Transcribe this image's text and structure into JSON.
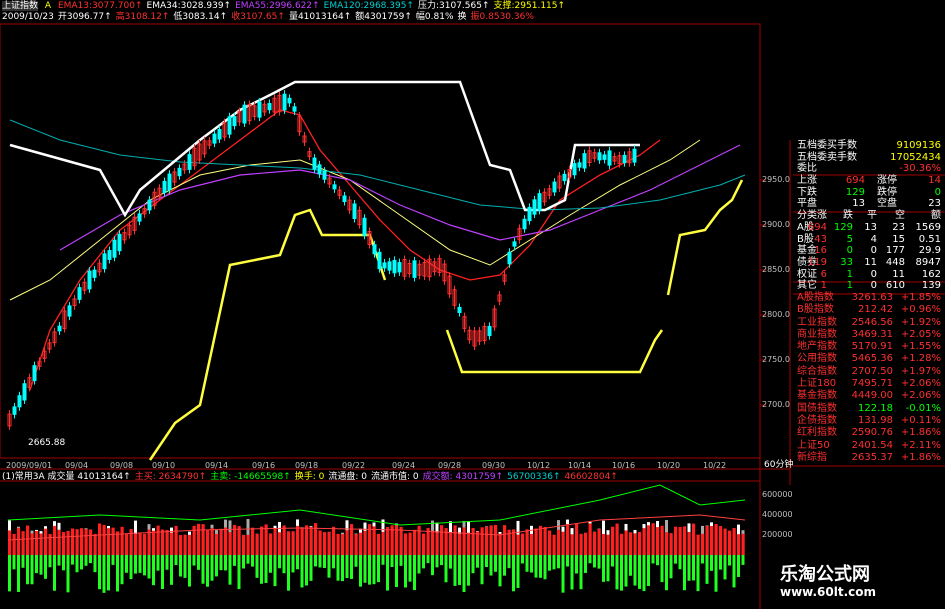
{
  "header1": {
    "title": "上证指数",
    "a_label": "A",
    "ema_items": [
      {
        "text": "EMA13:3077.700↑",
        "color": "#ff3030"
      },
      {
        "text": "EMA34:3028.939↑",
        "color": "#ffffff"
      },
      {
        "text": "EMA55:2996.622↑",
        "color": "#c040ff"
      },
      {
        "text": "EMA120:2968.395↑",
        "color": "#00d0d0"
      },
      {
        "text": "压力:3107.565↑",
        "color": "#ffffff"
      },
      {
        "text": "支撑:2951.115↑",
        "color": "#ffff00"
      }
    ]
  },
  "header2": {
    "items": [
      {
        "text": "2009/10/23",
        "color": "#ffffff"
      },
      {
        "text": "开3096.77↑",
        "color": "#ffffff"
      },
      {
        "text": "高3108.12↑",
        "color": "#ff3030"
      },
      {
        "text": "低3083.14↑",
        "color": "#ffffff"
      },
      {
        "text": "收3107.65↑",
        "color": "#ff3030"
      },
      {
        "text": "量41013164↑",
        "color": "#ffffff"
      },
      {
        "text": "额4301759↑",
        "color": "#ffffff"
      },
      {
        "text": "幅0.81%",
        "color": "#ffffff"
      },
      {
        "text": "换",
        "color": "#ffffff"
      },
      {
        "text": "振0.8530.36%",
        "color": "#ff3030"
      }
    ]
  },
  "low_label": "2665.88",
  "price_axis": [
    "2950.0",
    "2900.0",
    "2850.0",
    "2800.0",
    "2750.0",
    "2700.0"
  ],
  "date_axis": [
    "2009/09/01",
    "09/04",
    "09/08",
    "09/10",
    "09/14",
    "09/16",
    "09/18",
    "09/22",
    "09/24",
    "09/28",
    "09/30",
    "10/12",
    "10/14",
    "10/16",
    "10/20",
    "10/22"
  ],
  "period_label": "60分钟",
  "indicator_header": {
    "items": [
      {
        "text": "(1)常用3A 成交量 41013164↑",
        "color": "#ffffff"
      },
      {
        "text": "主买: 2634790↑",
        "color": "#ff3030"
      },
      {
        "text": "主卖: -14665598↑",
        "color": "#00ff00"
      },
      {
        "text": "换手: 0",
        "color": "#ffff00"
      },
      {
        "text": "流通盘: 0",
        "color": "#ffffff"
      },
      {
        "text": "流通市值: 0",
        "color": "#ffffff"
      },
      {
        "text": "成交额: 4301759↑",
        "color": "#c040ff"
      },
      {
        "text": "56700336↑",
        "color": "#00d0d0"
      },
      {
        "text": "46602804↑",
        "color": "#ff3030"
      }
    ]
  },
  "volume_axis": [
    "600000",
    "400000",
    "200000"
  ],
  "panel": {
    "top_rows": [
      {
        "label": "五档委买手数",
        "value": "9109136",
        "vcolor": "#ffff00"
      },
      {
        "label": "五档委卖手数",
        "value": "17052434",
        "vcolor": "#ffff00"
      },
      {
        "label": "委比",
        "value": "-30.36%",
        "vcolor": "#ff3030"
      }
    ],
    "updown": [
      {
        "a": "上涨",
        "av": "694",
        "b": "涨停",
        "bv": "14",
        "avc": "#ff3030",
        "bvc": "#ff3030"
      },
      {
        "a": "下跌",
        "av": "129",
        "b": "跌停",
        "bv": "0",
        "avc": "#00ff00",
        "bvc": "#00ff00"
      },
      {
        "a": "平盘",
        "av": "13",
        "b": "空盘",
        "bv": "23",
        "avc": "#ffffff",
        "bvc": "#ffffff"
      }
    ],
    "class_header": [
      "分类",
      "涨",
      "跌",
      "平",
      "空",
      "额"
    ],
    "class_rows": [
      {
        "name": "A股",
        "up": "694",
        "down": "129",
        "flat": "13",
        "empty": "23",
        "amt": "1569"
      },
      {
        "name": "B股",
        "up": "43",
        "down": "5",
        "flat": "4",
        "empty": "15",
        "amt": "0.51"
      },
      {
        "name": "基金",
        "up": "16",
        "down": "0",
        "flat": "0",
        "empty": "177",
        "amt": "29.9"
      },
      {
        "name": "债券",
        "up": "119",
        "down": "33",
        "flat": "11",
        "empty": "448",
        "amt": "8947"
      },
      {
        "name": "权证",
        "up": "6",
        "down": "1",
        "flat": "0",
        "empty": "11",
        "amt": "162"
      },
      {
        "name": "其它",
        "up": "1",
        "down": "1",
        "flat": "0",
        "empty": "610",
        "amt": "139"
      }
    ],
    "index_rows": [
      {
        "name": "A股指数",
        "value": "3261.63",
        "pct": "+1.85%",
        "pcolor": "#ff3030"
      },
      {
        "name": "B股指数",
        "value": "212.42",
        "pct": "+0.96%",
        "pcolor": "#ff3030"
      },
      {
        "name": "工业指数",
        "value": "2546.56",
        "pct": "+1.92%",
        "pcolor": "#ff3030"
      },
      {
        "name": "商业指数",
        "value": "3469.31",
        "pct": "+2.05%",
        "pcolor": "#ff3030"
      },
      {
        "name": "地产指数",
        "value": "5170.91",
        "pct": "+1.55%",
        "pcolor": "#ff3030"
      },
      {
        "name": "公用指数",
        "value": "5465.36",
        "pct": "+1.28%",
        "pcolor": "#ff3030"
      },
      {
        "name": "综合指数",
        "value": "2707.50",
        "pct": "+1.97%",
        "pcolor": "#ff3030"
      },
      {
        "name": "上证180",
        "value": "7495.71",
        "pct": "+2.06%",
        "pcolor": "#ff3030"
      },
      {
        "name": "基金指数",
        "value": "4449.00",
        "pct": "+2.06%",
        "pcolor": "#ff3030"
      },
      {
        "name": "国债指数",
        "value": "122.18",
        "pct": "-0.01%",
        "pcolor": "#00ff00"
      },
      {
        "name": "企债指数",
        "value": "131.98",
        "pct": "+0.11%",
        "pcolor": "#ff3030"
      },
      {
        "name": "红利指数",
        "value": "2590.76",
        "pct": "+1.86%",
        "pcolor": "#ff3030"
      },
      {
        "name": "上证50",
        "value": "2401.54",
        "pct": "+2.11%",
        "pcolor": "#ff3030"
      },
      {
        "name": "新综指",
        "value": "2635.37",
        "pct": "+1.86%",
        "pcolor": "#ff3030"
      }
    ]
  },
  "watermark": {
    "title": "乐淘公式网",
    "url": "www.60lt.com"
  },
  "colors": {
    "up": "#ff3030",
    "down": "#00ffff",
    "ema13": "#ff2020",
    "ema34": "#ffff80",
    "ema55": "#c040ff",
    "ema120": "#00b0b0",
    "pressure": "#ffffff",
    "support": "#ffff40",
    "grid": "#a00000"
  }
}
